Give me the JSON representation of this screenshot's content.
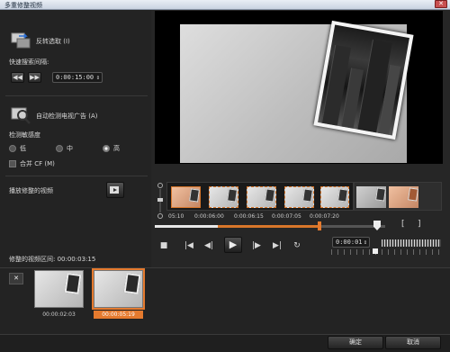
{
  "window": {
    "title": "多重修整视频",
    "close_label": "✕"
  },
  "left": {
    "reverse_select": "反转选取 (I)",
    "fast_search_label": "快速搜索间隔:",
    "rewind_btn": "◀◀",
    "forward_btn": "▶▶",
    "interval_value": "0:00:15:00",
    "auto_detect": "自动检测电视广告 (A)",
    "sensitivity_label": "检测敏感度",
    "sensitivity_options": [
      "低",
      "中",
      "高"
    ],
    "sensitivity_selected": "高",
    "merge_cf": "合并 CF (M)",
    "play_trimmed": "播放修整的视频"
  },
  "timeline": {
    "timestamps": [
      "05:10",
      "0:00:06:00",
      "0:00:06:15",
      "0:00:07:05",
      "0:00:07:20"
    ],
    "in_bracket": "[",
    "out_bracket": "]",
    "timecode": "0:00:01"
  },
  "transport": {
    "stop": "■",
    "prev_start": "|◀",
    "prev_frame": "◀|",
    "play": "▶",
    "next_frame": "|▶",
    "next_end": "▶|",
    "repeat": "↻"
  },
  "bottom": {
    "trimmed_duration_label": "修整的视频区间: 00:00:03:15",
    "clips": [
      "00:00:02:03",
      "00:00:05:19"
    ],
    "remove_btn": "✕"
  },
  "footer": {
    "ok": "确定",
    "cancel": "取消"
  },
  "colors": {
    "accent": "#e57a2e",
    "bg": "#262626"
  }
}
